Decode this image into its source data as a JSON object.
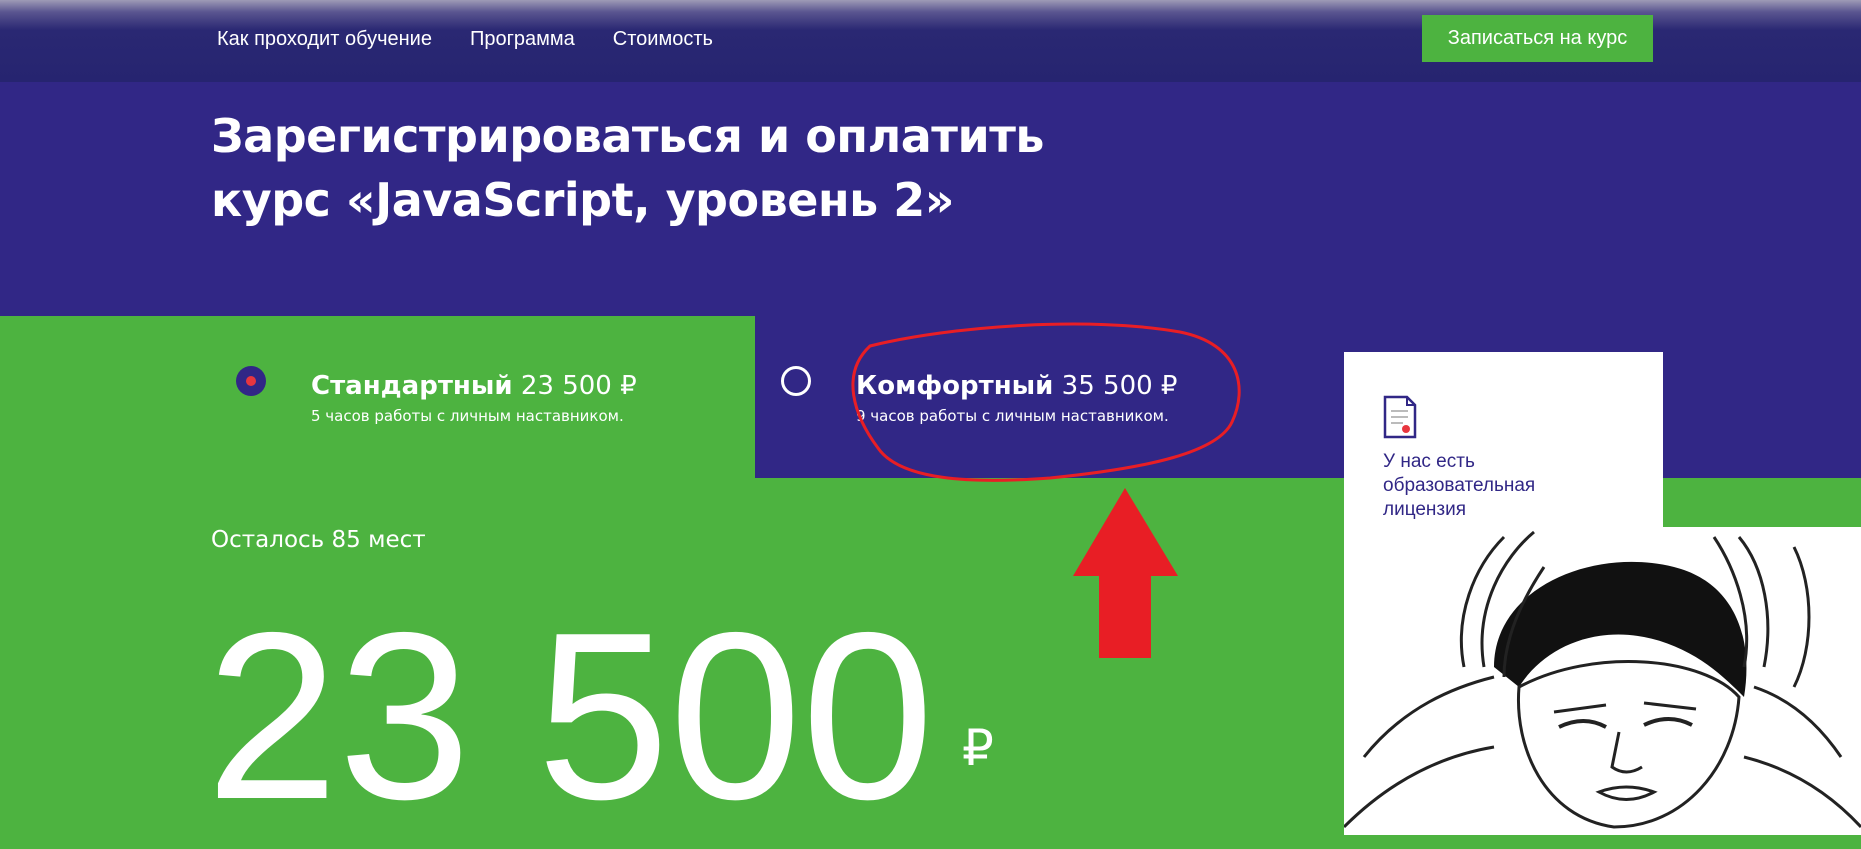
{
  "header": {
    "nav": [
      {
        "label": "Как проходит обучение"
      },
      {
        "label": "Программа"
      },
      {
        "label": "Стоимость"
      }
    ],
    "cta_label": "Записаться на курс"
  },
  "hero": {
    "title_line1": "Зарегистрироваться и оплатить",
    "title_line2": "курс «JavaScript, уровень 2»"
  },
  "tariffs": [
    {
      "name": "Стандартный",
      "price": "23 500 ₽",
      "description": "5 часов работы с личным наставником.",
      "selected": true
    },
    {
      "name": "Комфортный",
      "price": "35 500 ₽",
      "description": "9 часов работы с личным наставником.",
      "selected": false
    }
  ],
  "seats_left": "Осталось 85 мест",
  "price": {
    "value": "23 500",
    "currency": "₽"
  },
  "license": {
    "text": "У нас есть образовательная лицензия",
    "icon": "document-icon"
  },
  "colors": {
    "navy": "#312786",
    "green": "#4db340",
    "annotation_red": "#e81e25",
    "radio_dot": "#e8363f"
  }
}
